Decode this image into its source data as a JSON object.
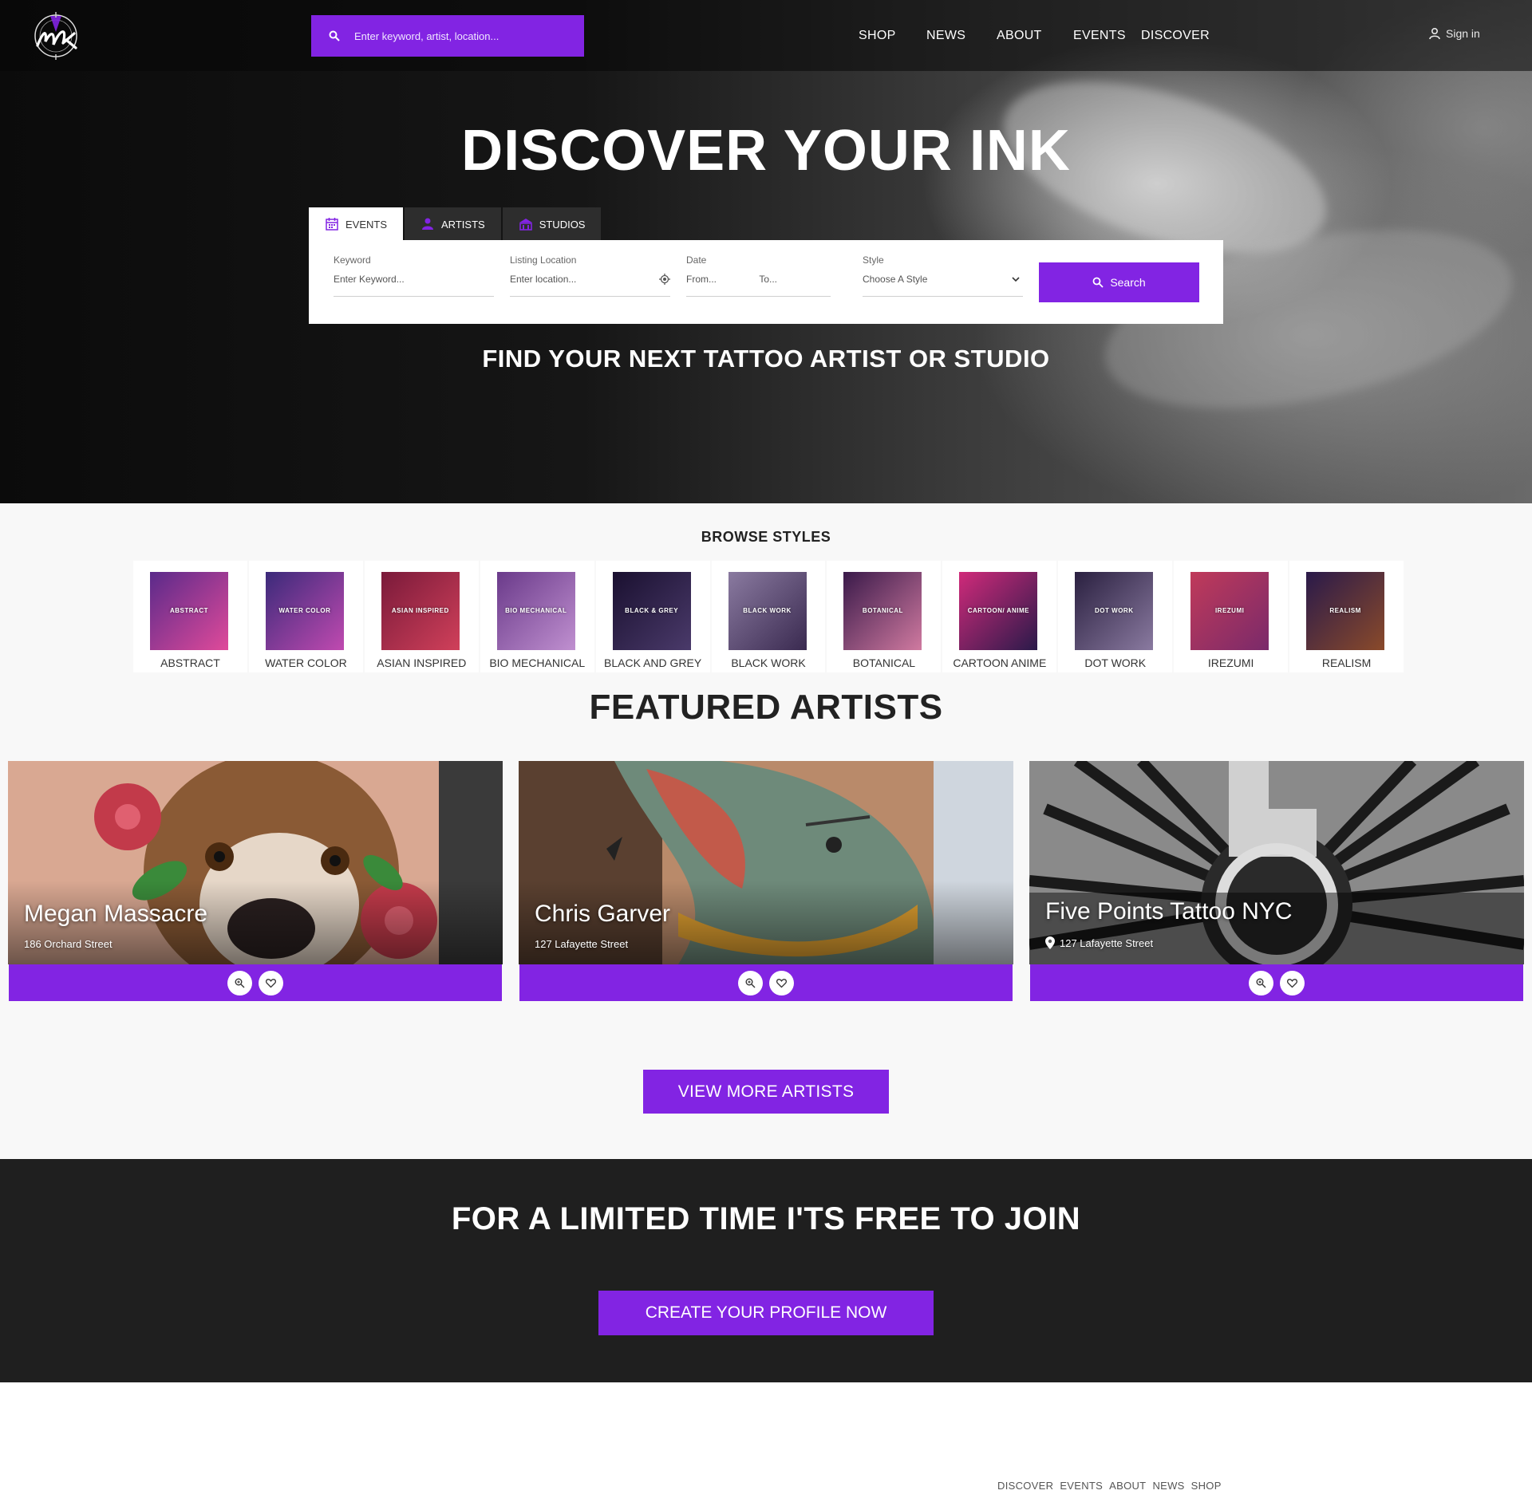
{
  "header": {
    "search_placeholder": "Enter keyword, artist, location...",
    "nav": [
      "SHOP",
      "NEWS",
      "ABOUT",
      "EVENTS",
      "DISCOVER"
    ],
    "signin": "Sign in"
  },
  "hero": {
    "title": "DISCOVER YOUR INK",
    "tabs": [
      "EVENTS",
      "ARTISTS",
      "STUDIOS"
    ],
    "fields": {
      "keyword_label": "Keyword",
      "keyword_placeholder": "Enter Keyword...",
      "location_label": "Listing Location",
      "location_placeholder": "Enter location...",
      "date_label": "Date",
      "date_from": "From...",
      "date_to": "To...",
      "style_label": "Style",
      "style_value": "Choose A Style"
    },
    "search_button": "Search",
    "subtitle": "FIND YOUR NEXT TATTOO ARTIST OR STUDIO"
  },
  "styles": {
    "title": "BROWSE STYLES",
    "items": [
      {
        "label": "ABSTRACT",
        "thumb": "ABSTRACT",
        "c1": "#5a2a8a",
        "c2": "#e04a9a"
      },
      {
        "label": "WATER COLOR",
        "thumb": "WATER COLOR",
        "c1": "#3b2a7a",
        "c2": "#c04ab0"
      },
      {
        "label": "ASIAN INSPIRED",
        "thumb": "ASIAN INSPIRED",
        "c1": "#7a1a3a",
        "c2": "#d0405a"
      },
      {
        "label": "BIO MECHANICAL",
        "thumb": "BIO MECHANICAL",
        "c1": "#6a3a8a",
        "c2": "#c090d0"
      },
      {
        "label": "BLACK AND GREY",
        "thumb": "BLACK & GREY",
        "c1": "#1a1030",
        "c2": "#4a3a6a"
      },
      {
        "label": "BLACK WORK",
        "thumb": "BLACK WORK",
        "c1": "#8a7aa0",
        "c2": "#3a2a50"
      },
      {
        "label": "BOTANICAL",
        "thumb": "BOTANICAL",
        "c1": "#3a1a4a",
        "c2": "#d07aa0"
      },
      {
        "label": "CARTOON ANIME",
        "thumb": "CARTOON/ ANIME",
        "c1": "#d02a7a",
        "c2": "#2a1a4a"
      },
      {
        "label": "DOT WORK",
        "thumb": "DOT WORK",
        "c1": "#2a2040",
        "c2": "#8a7aa0"
      },
      {
        "label": "IREZUMI",
        "thumb": "IREZUMI",
        "c1": "#c03a5a",
        "c2": "#7a2a6a"
      },
      {
        "label": "REALISM",
        "thumb": "REALISM",
        "c1": "#2a1a4a",
        "c2": "#8a4a2a"
      }
    ]
  },
  "featured": {
    "title": "FEATURED ARTISTS",
    "artists": [
      {
        "name": "Megan Massacre",
        "address": "186 Orchard Street"
      },
      {
        "name": "Chris Garver",
        "address": "127 Lafayette Street"
      },
      {
        "name": "Five Points Tattoo NYC",
        "address": "127 Lafayette Street"
      }
    ],
    "view_more": "VIEW MORE ARTISTS"
  },
  "join": {
    "title": "FOR A LIMITED TIME I'TS FREE TO JOIN",
    "button": "CREATE YOUR PROFILE NOW"
  },
  "footer": {
    "nav": [
      "DISCOVER",
      "EVENTS",
      "ABOUT",
      "NEWS",
      "SHOP"
    ]
  },
  "colors": {
    "accent": "#8224e3",
    "dark": "#1f1f1f"
  }
}
